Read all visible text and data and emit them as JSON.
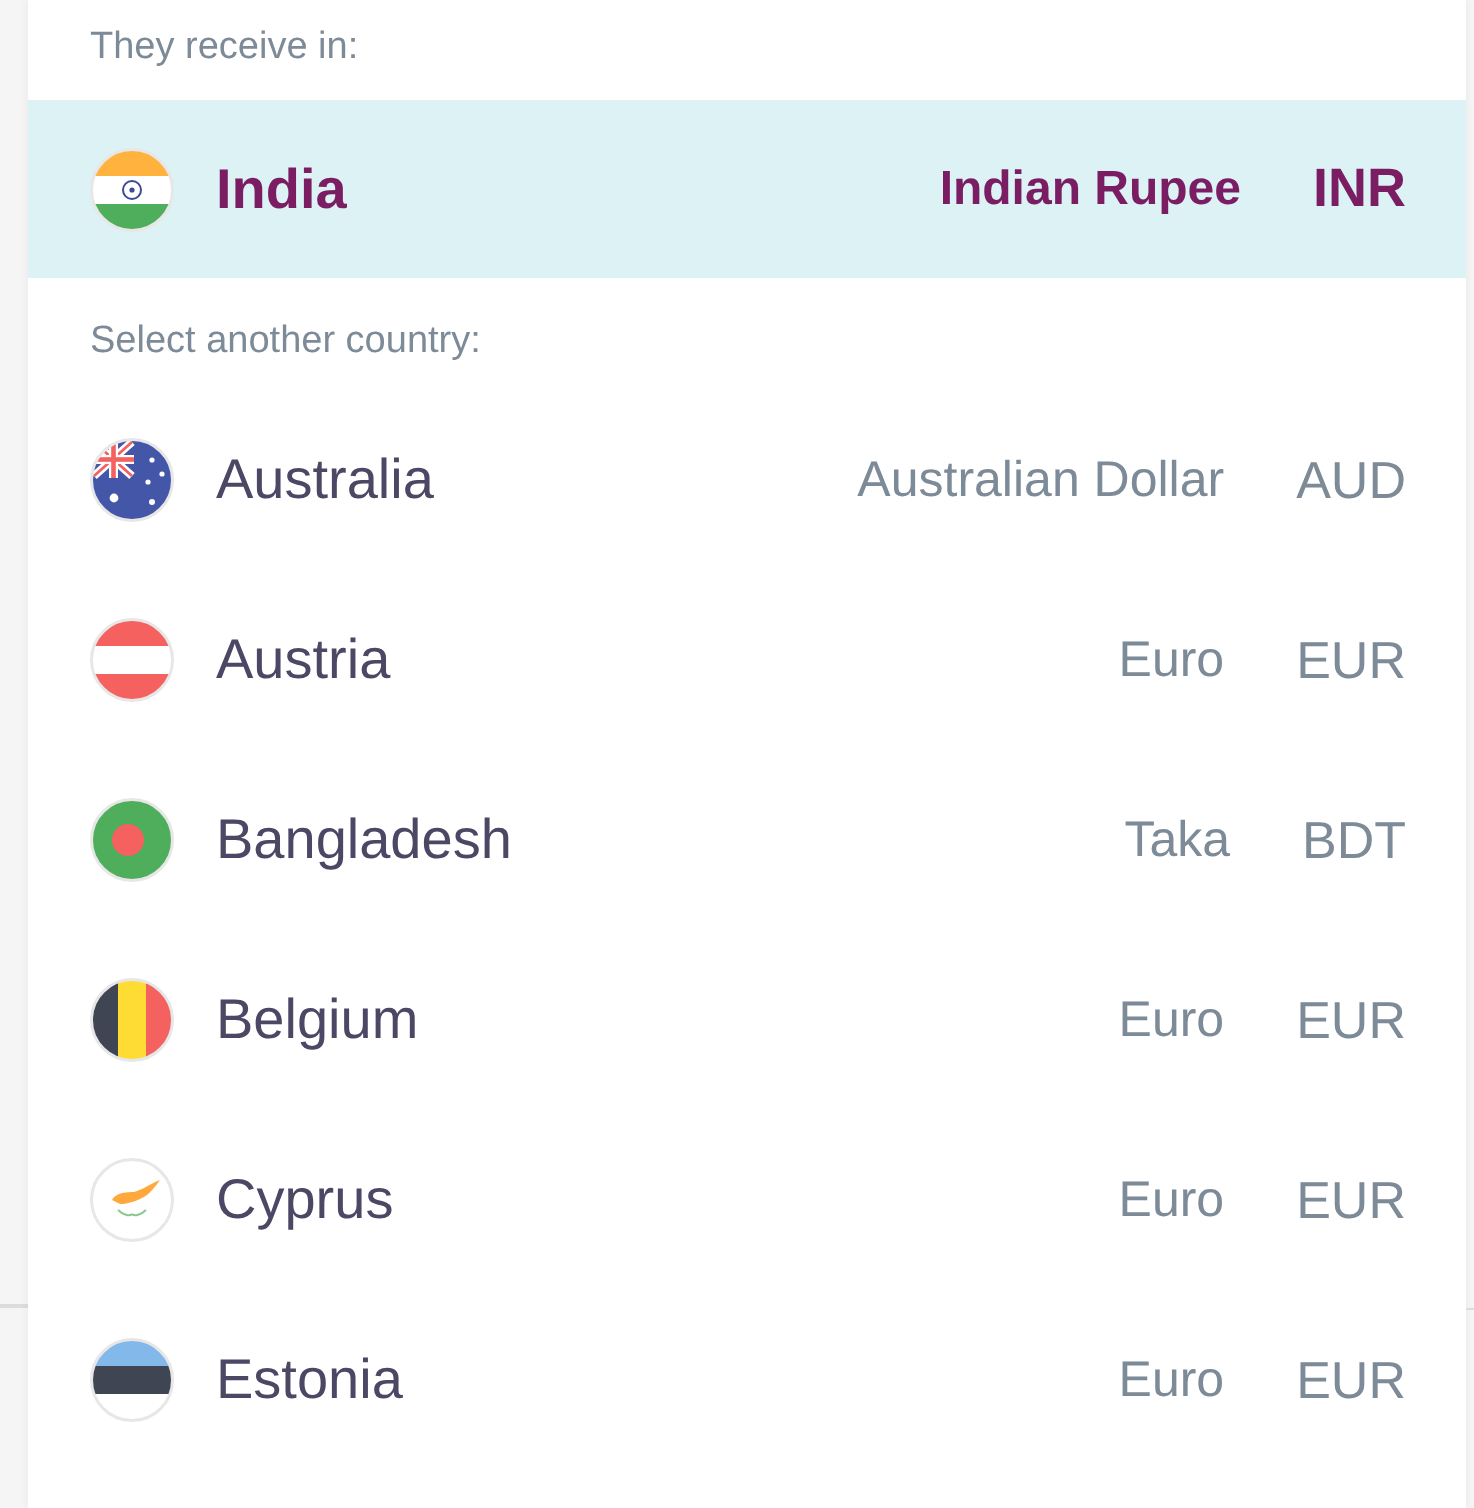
{
  "receive": {
    "label": "They receive in:",
    "options": [
      {
        "kind": "india",
        "country": "India",
        "currency": "Indian Rupee",
        "code": "INR",
        "selected": true
      }
    ]
  },
  "other": {
    "label": "Select another country:",
    "options": [
      {
        "kind": "australia",
        "country": "Australia",
        "currency": "Australian Dollar",
        "code": "AUD",
        "selected": false
      },
      {
        "kind": "austria",
        "country": "Austria",
        "currency": "Euro",
        "code": "EUR",
        "selected": false
      },
      {
        "kind": "bangladesh",
        "country": "Bangladesh",
        "currency": "Taka",
        "code": "BDT",
        "selected": false
      },
      {
        "kind": "belgium",
        "country": "Belgium",
        "currency": "Euro",
        "code": "EUR",
        "selected": false
      },
      {
        "kind": "cyprus",
        "country": "Cyprus",
        "currency": "Euro",
        "code": "EUR",
        "selected": false
      },
      {
        "kind": "estonia",
        "country": "Estonia",
        "currency": "Euro",
        "code": "EUR",
        "selected": false
      }
    ]
  }
}
